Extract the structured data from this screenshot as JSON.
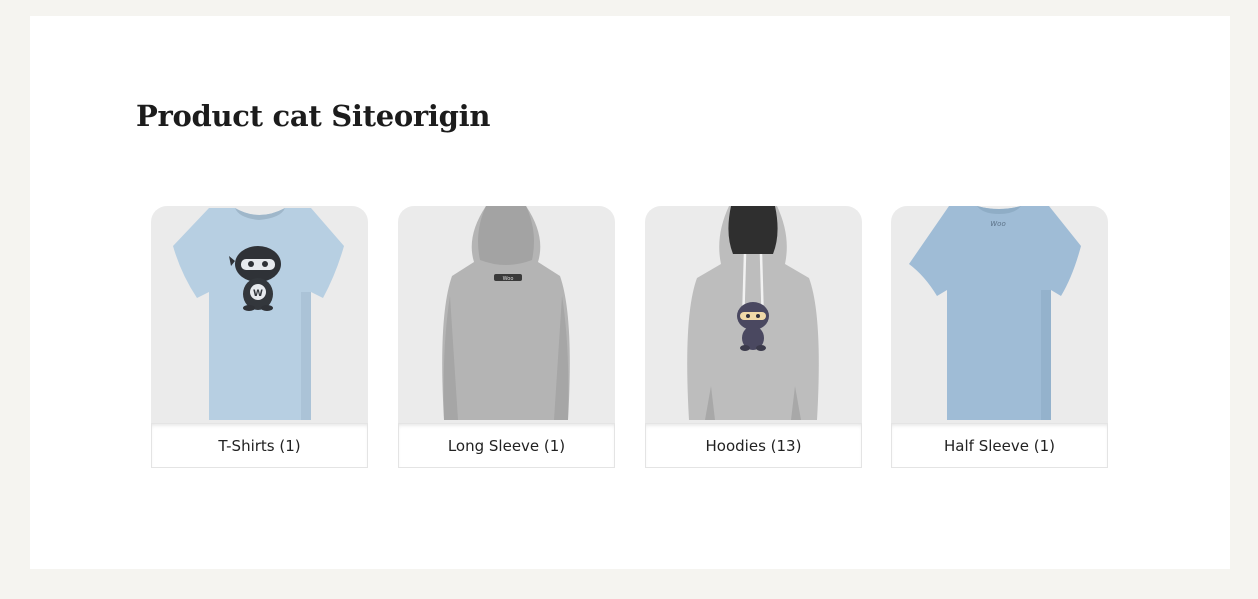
{
  "page": {
    "title": "Product cat Siteorigin"
  },
  "categories": [
    {
      "name": "T-Shirts (1)",
      "thumbnail_icon": "t-shirt-ninja-icon"
    },
    {
      "name": "Long Sleeve (1)",
      "thumbnail_icon": "hoodie-back-icon"
    },
    {
      "name": "Hoodies (13)",
      "thumbnail_icon": "hoodie-ninja-icon"
    },
    {
      "name": "Half Sleeve (1)",
      "thumbnail_icon": "t-shirt-back-icon"
    }
  ],
  "thumbnail_text": {
    "woo": "Woo"
  },
  "colors": {
    "page_background": "#f5f4f0",
    "panel_background": "#ffffff",
    "thumb_background": "#ebebeb",
    "shirt_light_blue": "#b7cfe2",
    "shirt_blue": "#9fbcd6",
    "hoodie_gray": "#b9b9b9"
  }
}
